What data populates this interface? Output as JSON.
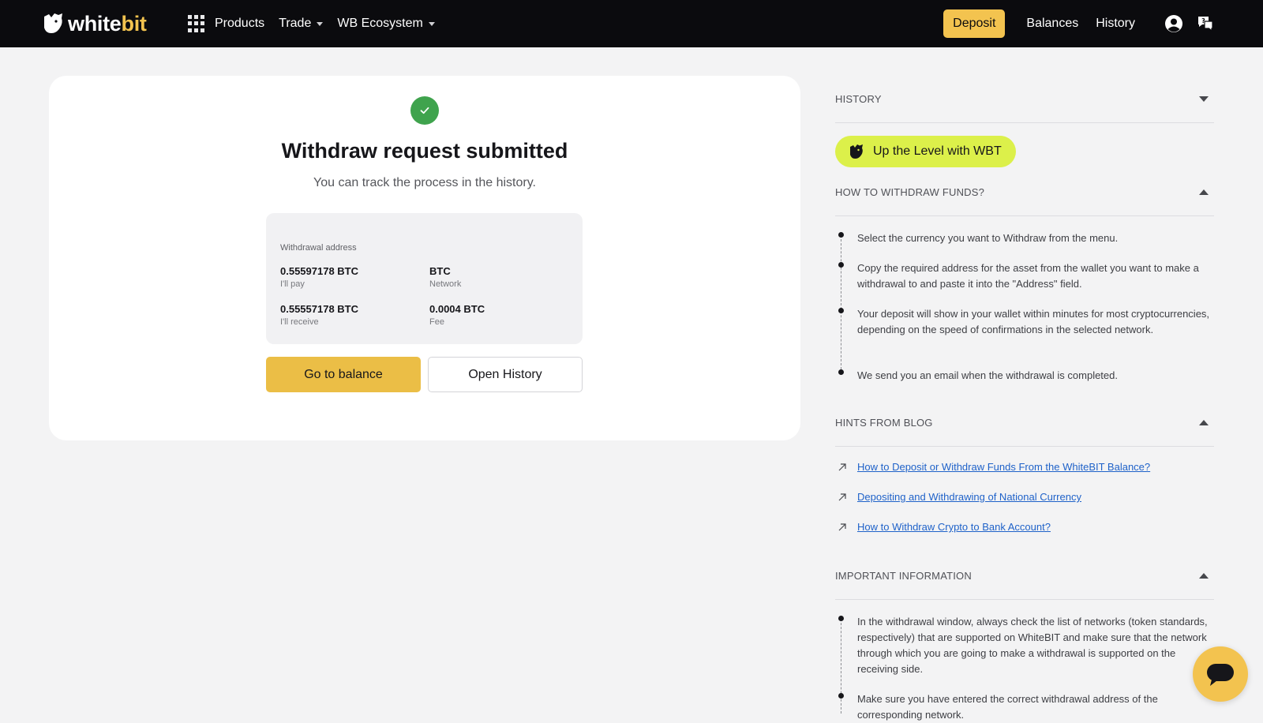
{
  "header": {
    "logo": {
      "part1": "white",
      "part2": "bit"
    },
    "nav": {
      "products": "Products",
      "trade": "Trade",
      "ecosystem": "WB Ecosystem"
    },
    "deposit": "Deposit",
    "balances": "Balances",
    "history": "History"
  },
  "card": {
    "title": "Withdraw request submitted",
    "subtitle": "You can track the process in the history.",
    "info_label": "Withdrawal address",
    "pay": {
      "value": "0.55597178 BTC",
      "label": "I'll pay"
    },
    "network": {
      "value": "BTC",
      "label": "Network"
    },
    "receive": {
      "value": "0.55557178 BTC",
      "label": "I'll receive"
    },
    "fee": {
      "value": "0.0004 BTC",
      "label": "Fee"
    },
    "btn_balance": "Go to balance",
    "btn_history": "Open History"
  },
  "sidebar": {
    "history_title": "HISTORY",
    "wbt_pill": "Up the Level with WBT",
    "howto_title": "HOW TO WITHDRAW FUNDS?",
    "steps": [
      "Select the currency you want to Withdraw from the menu.",
      "Copy the required address for the asset from the wallet you want to make a withdrawal to and paste it into the \"Address\" field.",
      "Your deposit will show in your wallet within minutes for most cryptocurrencies, depending on the speed of confirmations in the selected network.",
      "We send you an email when the withdrawal is completed."
    ],
    "blog_title": "HINTS FROM BLOG",
    "blog_links": [
      "How to Deposit or Withdraw Funds From the WhiteBIT Balance?",
      "Depositing and Withdrawing of National Currency",
      "How to Withdraw Crypto to Bank Account?"
    ],
    "important_title": "IMPORTANT INFORMATION",
    "important_items": [
      "In the withdrawal window, always check the list of networks (token standards, respectively) that are supported on WhiteBIT and make sure that the network through which you are going to make a withdrawal is supported on the receiving side.",
      "Make sure you have entered the correct withdrawal address of the corresponding network."
    ]
  },
  "colors": {
    "accent": "#f3c34f",
    "success": "#3fa34d",
    "link": "#1f62c9",
    "wbt": "#dcf04a",
    "topbar": "#0b0b0e"
  }
}
